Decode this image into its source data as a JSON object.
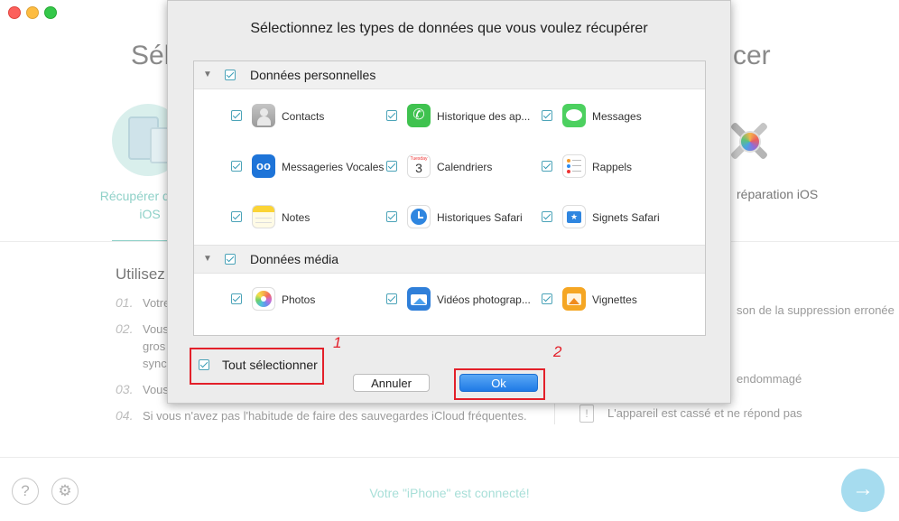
{
  "colors": {
    "accent": "#4ba3b8",
    "highlight_red": "#e3202a",
    "ok_blue": "#2d8cf0",
    "bg_green": "#8fd1c8"
  },
  "background": {
    "title_left": "Sél",
    "title_right": "cer",
    "recover_ios_label": "Récupérer depuis l'appareil iOS",
    "recover_ios_label_line1": "Récupérer depuis",
    "recover_ios_label_line2": "iOS",
    "repair_label": "réparation iOS",
    "left_heading": "Utilisez",
    "left_items": [
      {
        "num": "01.",
        "text": "Votre"
      },
      {
        "num": "02.",
        "text": "Vous"
      },
      {
        "num": "",
        "text": "gros"
      },
      {
        "num": "",
        "text": "sync"
      },
      {
        "num": "03.",
        "text": "Vous"
      },
      {
        "num": "04.",
        "text": "Si vous n'avez pas l'habitude de faire des sauvegardes iCloud fréquentes."
      }
    ],
    "right_items": [
      "son de la suppression erronée",
      "endommagé",
      "L'appareil est cassé et ne répond pas"
    ],
    "status": "Votre \"iPhone\" est connecté!"
  },
  "dialog": {
    "title": "Sélectionnez les types de données que vous voulez récupérer",
    "groups": [
      {
        "label": "Données personnelles",
        "items": [
          {
            "label": "Contacts",
            "icon": "contacts-icon"
          },
          {
            "label": "Historique des ap...",
            "icon": "phone-icon"
          },
          {
            "label": "Messages",
            "icon": "messages-icon"
          },
          {
            "label": "Messageries Vocales",
            "icon": "voicemail-icon"
          },
          {
            "label": "Calendriers",
            "icon": "calendar-icon"
          },
          {
            "label": "Rappels",
            "icon": "reminders-icon"
          },
          {
            "label": "Notes",
            "icon": "notes-icon"
          },
          {
            "label": "Historiques Safari",
            "icon": "safari-history-icon"
          },
          {
            "label": "Signets Safari",
            "icon": "safari-bookmarks-icon"
          }
        ]
      },
      {
        "label": "Données média",
        "items": [
          {
            "label": "Photos",
            "icon": "photos-icon"
          },
          {
            "label": "Vidéos photograp...",
            "icon": "videos-icon"
          },
          {
            "label": "Vignettes",
            "icon": "thumbnails-icon"
          }
        ]
      }
    ],
    "calendar_day": "3",
    "calendar_weekday": "Tuesday",
    "select_all": "Tout sélectionner",
    "cancel": "Annuler",
    "ok": "Ok",
    "marker_1": "1",
    "marker_2": "2"
  },
  "footer": {
    "help": "?",
    "settings_icon": "gear-icon",
    "next_icon": "arrow-right-icon"
  }
}
